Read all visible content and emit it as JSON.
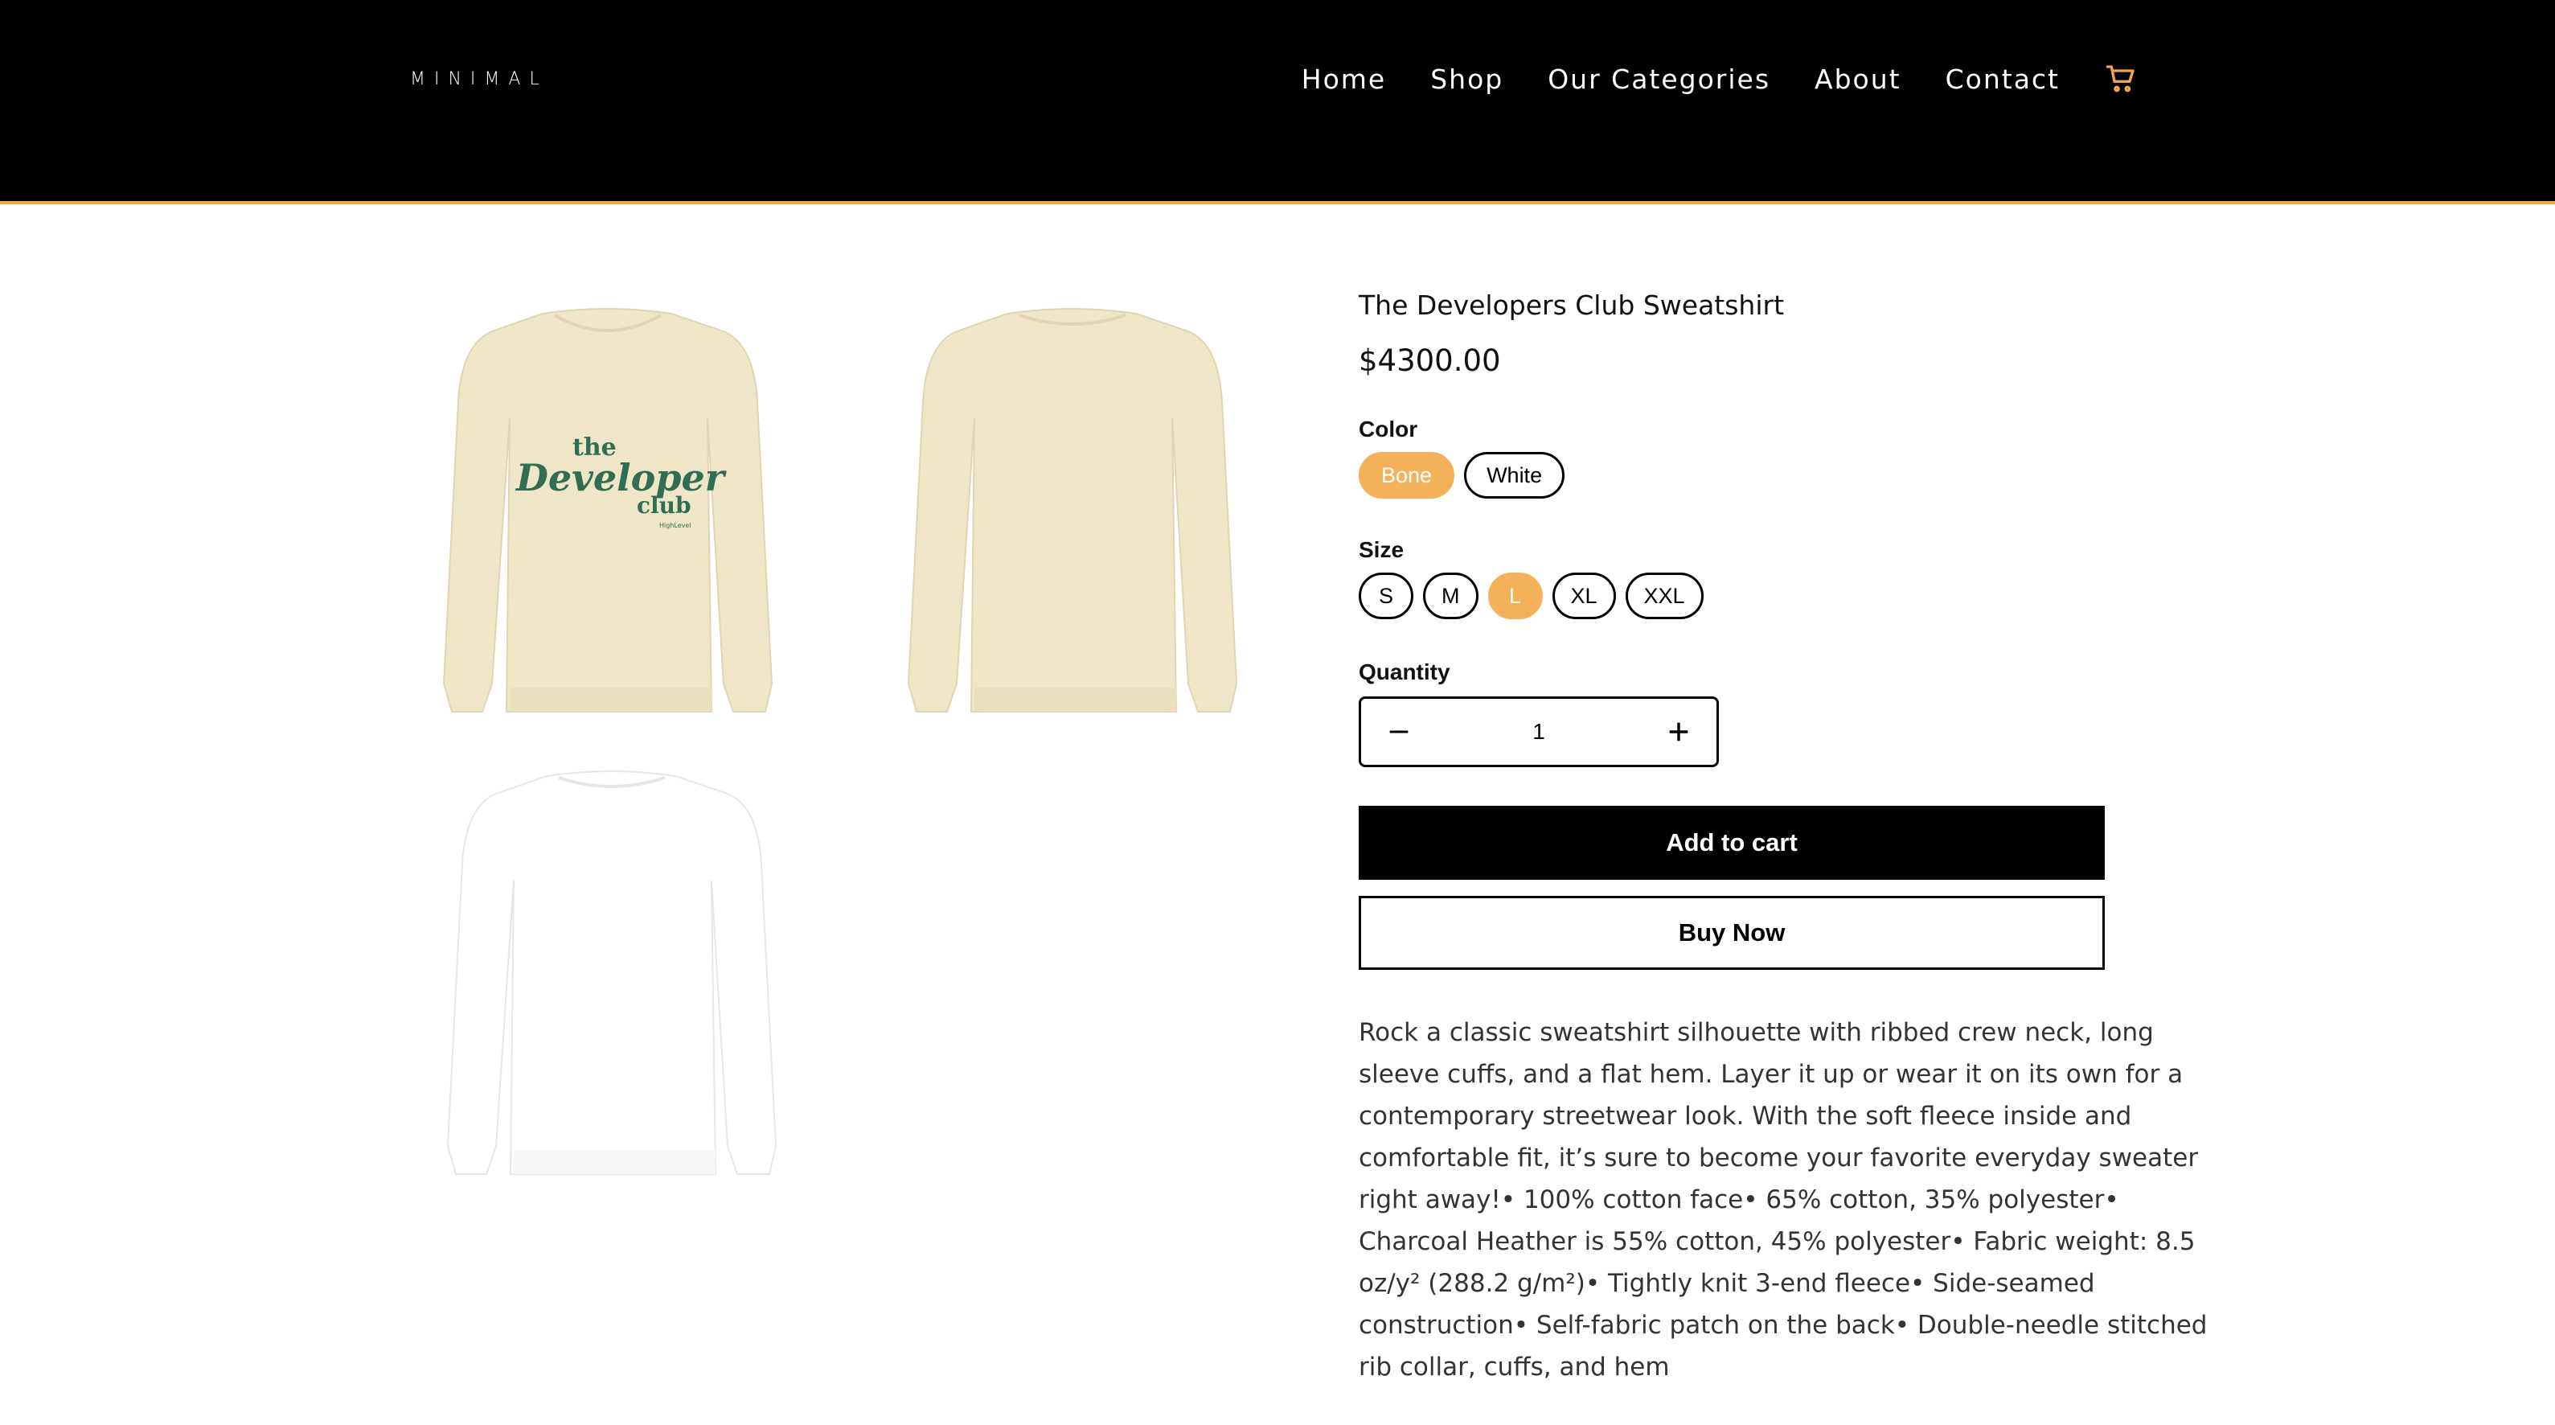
{
  "header": {
    "logo": "MINIMAL",
    "nav": [
      "Home",
      "Shop",
      "Our Categories",
      "About",
      "Contact"
    ],
    "cart_icon": "shopping-cart-icon",
    "accent_color": "#f2a64b"
  },
  "gallery": {
    "front_print": {
      "line1": "the",
      "line2": "Developer",
      "line3": "club",
      "tag": "HighLevel"
    },
    "colors": [
      "#efe6c8",
      "#efe6c8",
      "#ffffff"
    ]
  },
  "product": {
    "title": "The Developers Club Sweatshirt",
    "price": "$4300.00",
    "color_label": "Color",
    "colors": [
      "Bone",
      "White"
    ],
    "selected_color": "Bone",
    "size_label": "Size",
    "sizes": [
      "S",
      "M",
      "L",
      "XL",
      "XXL"
    ],
    "selected_size": "L",
    "quantity_label": "Quantity",
    "quantity": "1",
    "add_to_cart": "Add to cart",
    "buy_now": "Buy Now",
    "description": "Rock a classic sweatshirt silhouette with ribbed crew neck, long sleeve cuffs, and a flat hem. Layer it up or wear it on its own for a contemporary streetwear look. With the soft fleece inside and comfortable fit, it’s sure to become your favorite everyday sweater right away!• 100% cotton face• 65% cotton, 35% polyester• Charcoal Heather is 55% cotton, 45% polyester• Fabric weight: 8.5 oz/y² (288.2 g/m²)• Tightly knit 3-end fleece• Side-seamed construction• Self-fabric patch on the back• Double-needle stitched rib collar, cuffs, and hem",
    "selected_color_hex": "#f5b159"
  }
}
